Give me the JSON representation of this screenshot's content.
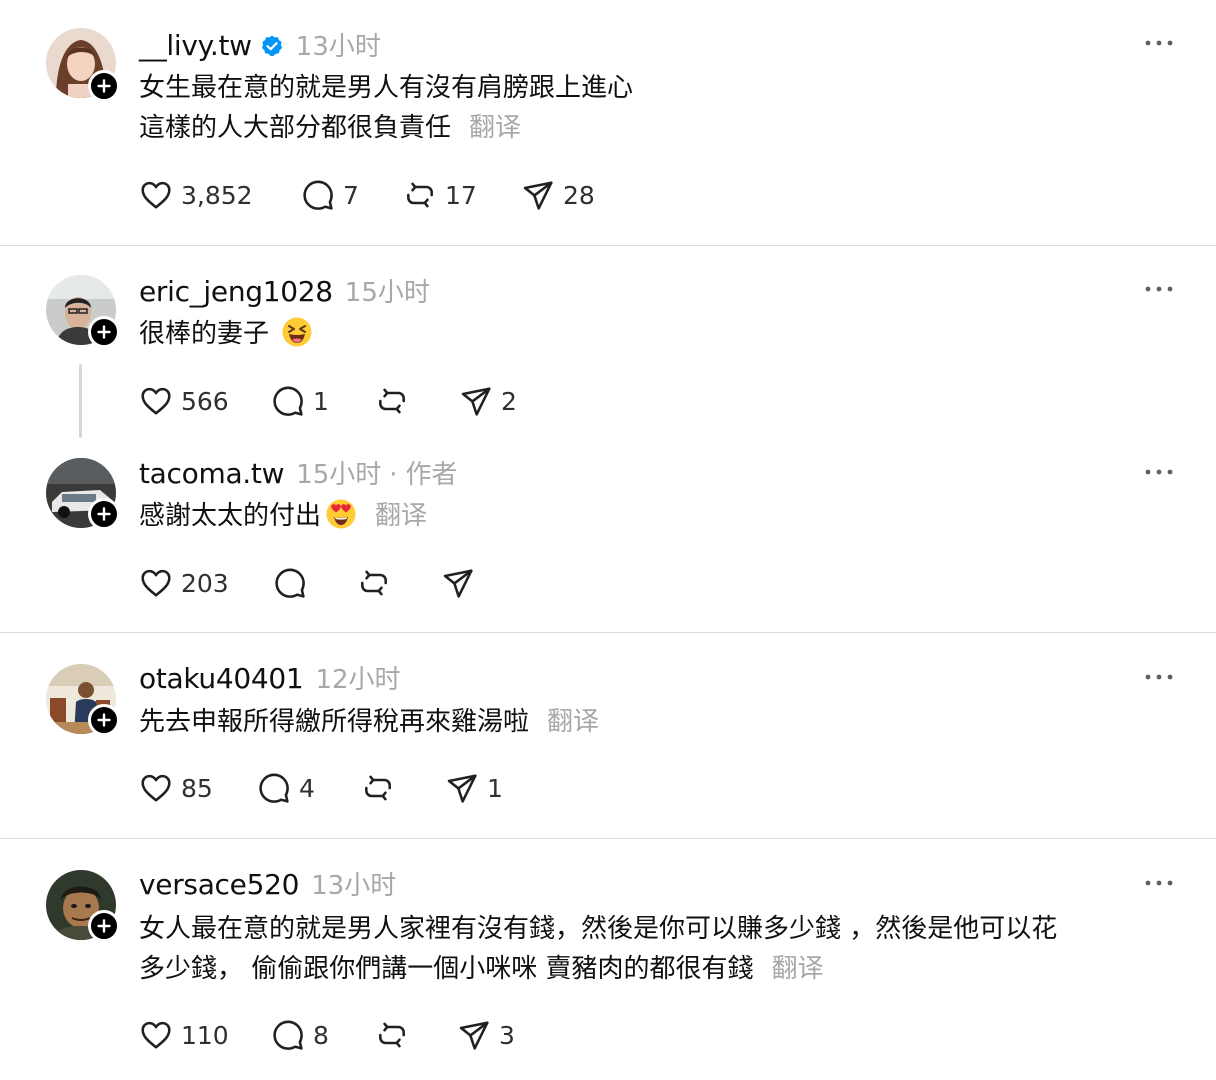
{
  "colors": {
    "text": "#101010",
    "muted": "#a8a8a8",
    "verified": "#0095f6",
    "divider": "#dcdcdc"
  },
  "posts": [
    {
      "username": "__livy.tw",
      "verified": true,
      "time": "13小时",
      "lines": [
        "女生最在意的就是男人有沒有肩膀跟上進心",
        "這樣的人大部分都很負責任"
      ],
      "translate": "翻译",
      "likes": "3,852",
      "replies": "7",
      "reposts": "17",
      "shares": "28"
    },
    {
      "username": "eric_jeng1028",
      "time": "15小时",
      "lines": [
        "很棒的妻子"
      ],
      "emoji": "grinning-squinting-face-emoji",
      "likes": "566",
      "replies": "1",
      "reposts": "",
      "shares": "2"
    },
    {
      "username": "tacoma.tw",
      "time": "15小时",
      "dot": "·",
      "author_tag": "作者",
      "lines": [
        "感謝太太的付出"
      ],
      "emoji": "heart-eyes-emoji",
      "translate": "翻译",
      "likes": "203",
      "replies": "",
      "reposts": "",
      "shares": ""
    },
    {
      "username": "otaku40401",
      "time": "12小时",
      "lines": [
        "先去申報所得繳所得稅再來雞湯啦"
      ],
      "translate": "翻译",
      "likes": "85",
      "replies": "4",
      "reposts": "",
      "shares": "1"
    },
    {
      "username": "versace520",
      "time": "13小时",
      "lines": [
        "女人最在意的就是男人家裡有沒有錢，然後是你可以賺多少錢 ，然後是他可以花",
        "多少錢， 偷偷跟你們講一個小咪咪 賣豬肉的都很有錢"
      ],
      "translate": "翻译",
      "likes": "110",
      "replies": "8",
      "reposts": "",
      "shares": "3"
    }
  ]
}
